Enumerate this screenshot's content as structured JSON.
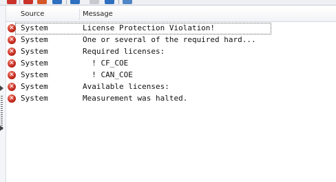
{
  "columns": {
    "source": "Source",
    "message": "Message"
  },
  "icons": {
    "error": "error-icon",
    "error_glyph": "✕"
  },
  "colors": {
    "error": "#c42a1e",
    "toolbar_red": "#c8332a",
    "toolbar_blue": "#2f6fbf"
  },
  "rows": [
    {
      "source": "System",
      "message": "License Protection Violation!",
      "selected": true
    },
    {
      "source": "System",
      "message": "One or several of the required hard...",
      "selected": false
    },
    {
      "source": "System",
      "message": "Required licenses:",
      "selected": false
    },
    {
      "source": "System",
      "message": "  ! CF_COE",
      "selected": false
    },
    {
      "source": "System",
      "message": "  ! CAN_COE",
      "selected": false
    },
    {
      "source": "System",
      "message": "Available licenses:",
      "selected": false
    },
    {
      "source": "System",
      "message": "Measurement was halted.",
      "selected": false
    }
  ]
}
